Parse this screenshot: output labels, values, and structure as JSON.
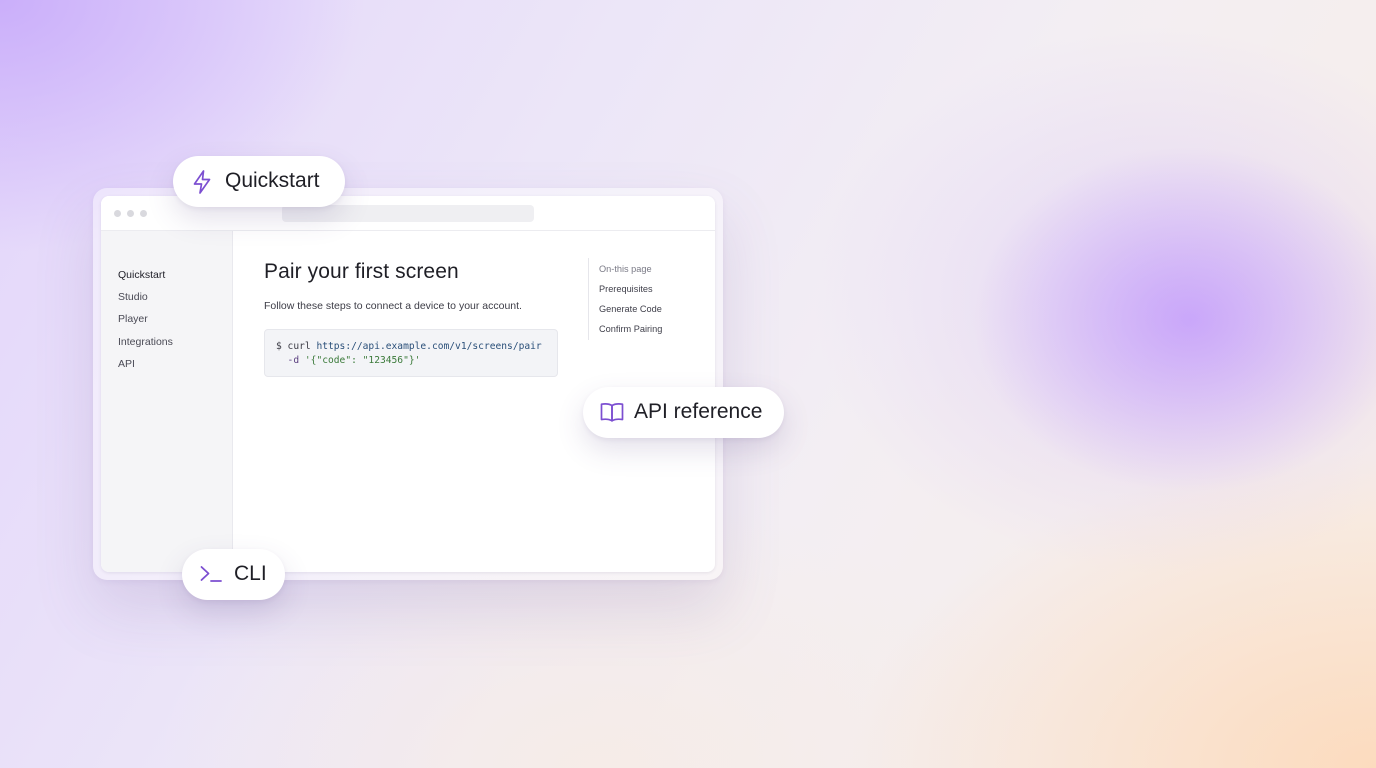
{
  "colors": {
    "accent": "#7c4fd1",
    "text_primary": "#1f1f26",
    "sidebar_bg": "#f5f5f7",
    "code_url": "#2a4f79",
    "code_string": "#3b7a3a"
  },
  "pills": {
    "quickstart": {
      "label": "Quickstart",
      "icon": "lightning-bolt-icon"
    },
    "api_reference": {
      "label": "API reference",
      "icon": "open-book-icon"
    },
    "cli": {
      "label": "CLI",
      "icon": "terminal-prompt-icon"
    }
  },
  "sidebar": {
    "items": [
      {
        "label": "Quickstart",
        "active": true
      },
      {
        "label": "Studio",
        "active": false
      },
      {
        "label": "Player",
        "active": false
      },
      {
        "label": "Integrations",
        "active": false
      },
      {
        "label": "API",
        "active": false
      }
    ]
  },
  "main": {
    "title": "Pair your first screen",
    "description": "Follow these steps to connect a device to your account.",
    "code": {
      "prompt": "$ curl ",
      "url": "https://api.example.com/v1/screens/pair",
      "flag": "  -d ",
      "payload": "'{\"code\": \"123456\"}'"
    }
  },
  "toc": {
    "heading": "On-this page",
    "items": [
      "Prerequisites",
      "Generate Code",
      "Confirm Pairing"
    ]
  }
}
